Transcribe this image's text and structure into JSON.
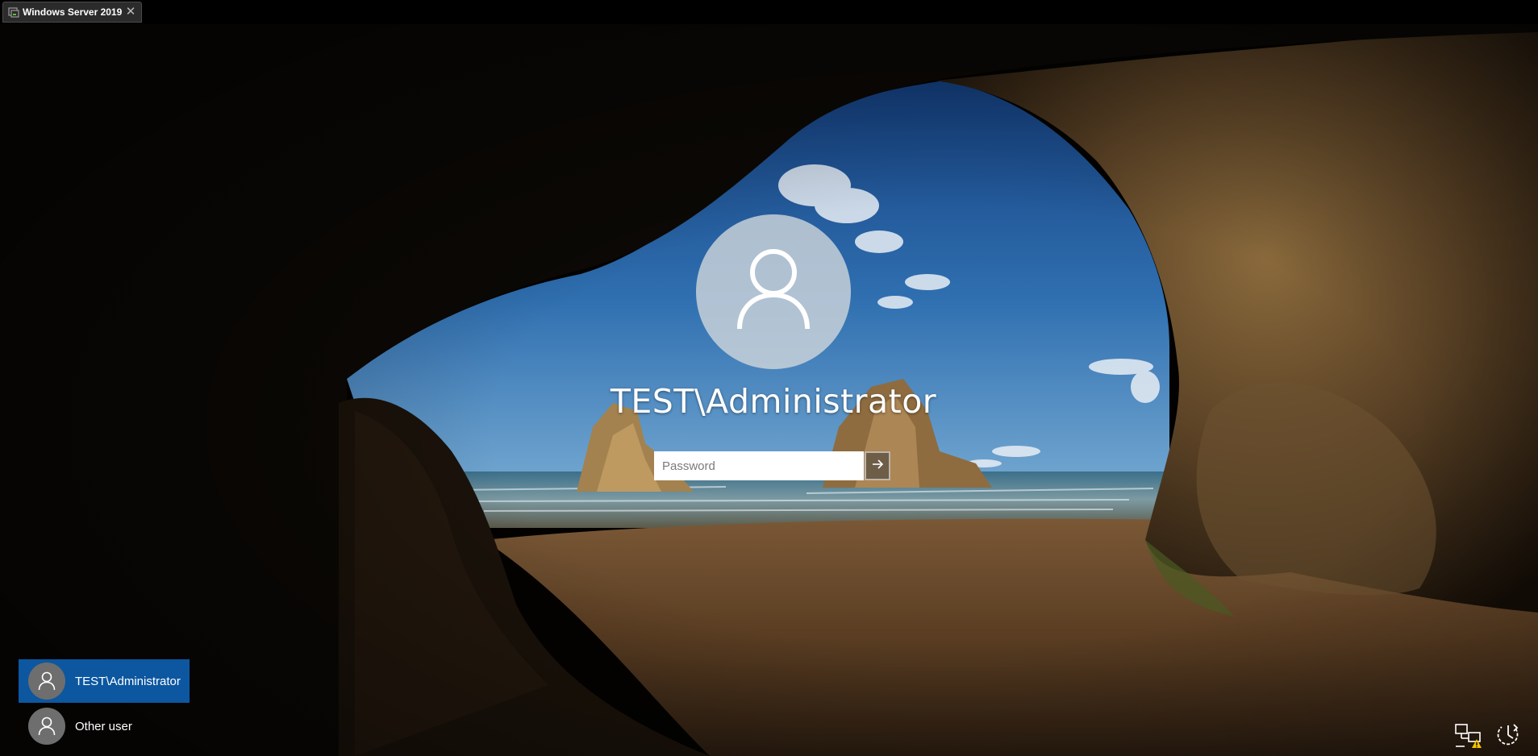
{
  "window": {
    "tab_title": "Windows Server 2019",
    "tab_icon": "vm-console-icon",
    "close_icon": "close-icon",
    "close_glyph": "✕"
  },
  "login": {
    "username": "TEST\\Administrator",
    "avatar_icon": "user-avatar-icon",
    "password_placeholder": "Password",
    "password_value": "",
    "submit_icon": "arrow-right-icon"
  },
  "users": [
    {
      "label": "TEST\\Administrator",
      "selected": true,
      "icon": "user-avatar-icon"
    },
    {
      "label": "Other user",
      "selected": false,
      "icon": "user-avatar-icon"
    }
  ],
  "system_tray": {
    "network_icon": "network-warning-icon",
    "power_icon": "power-options-icon"
  },
  "colors": {
    "selected_tile": "#0c57a0",
    "sky_top": "#1a4f94",
    "sky_bottom": "#4f8fc3",
    "sand": "#8a5a2e",
    "rock": "#5c4428"
  }
}
